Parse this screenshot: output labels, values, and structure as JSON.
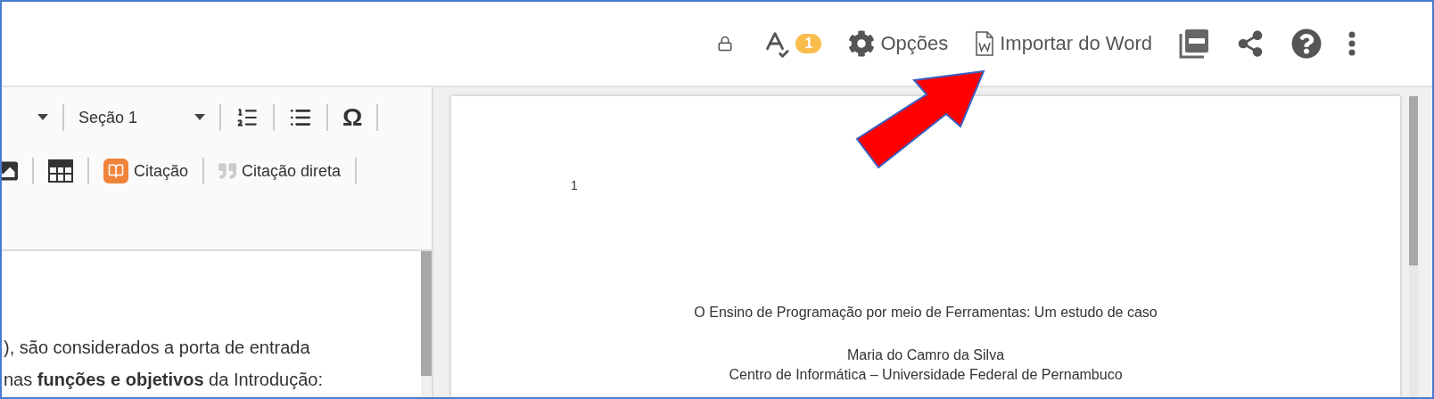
{
  "header": {
    "actions": [
      {
        "kind": "lock"
      },
      {
        "kind": "spellcheck",
        "badge": "1"
      },
      {
        "kind": "options",
        "label": "Opções"
      },
      {
        "kind": "import",
        "label": "Importar do Word"
      },
      {
        "kind": "pdf"
      },
      {
        "kind": "share"
      },
      {
        "kind": "help"
      },
      {
        "kind": "more"
      }
    ]
  },
  "toolbar": {
    "rows": [
      [
        {
          "kind": "dropdown"
        },
        {
          "kind": "dropdown",
          "label": "Seção 1"
        },
        {
          "kind": "numbered-list"
        },
        {
          "kind": "bulleted-list"
        },
        {
          "kind": "symbol",
          "label": "Ω"
        }
      ],
      [
        {
          "kind": "image"
        },
        {
          "kind": "table"
        },
        {
          "kind": "citation",
          "label": "Citação"
        },
        {
          "kind": "quote",
          "label": "Citação direta"
        }
      ]
    ]
  },
  "editor": {
    "lines": [
      "), são considerados a porta de entrada",
      "nas **funções e objetivos** da Introdução:"
    ]
  },
  "document": {
    "page_number": "1",
    "title": "O Ensino de Programação por meio de Ferramentas: Um estudo de caso",
    "author": "Maria do Camro da Silva",
    "affiliation": "Centro de Informática – Universidade Federal de Pernambuco"
  },
  "annotation": {
    "kind": "arrow"
  }
}
